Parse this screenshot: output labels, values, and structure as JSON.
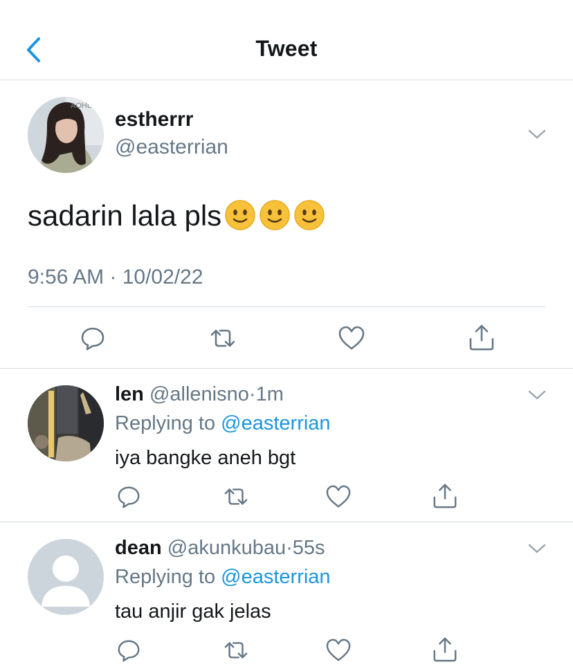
{
  "header": {
    "title": "Tweet",
    "back_icon": "chevron-left-icon"
  },
  "colors": {
    "accent": "#1b95e0",
    "muted": "#657786",
    "divider": "#d8dde1"
  },
  "tweet": {
    "display_name": "estherrr",
    "handle": "@easterrian",
    "text": "sadarin lala pls",
    "emoji": [
      "slightly-smiling-face-emoji",
      "slightly-smiling-face-emoji",
      "slightly-smiling-face-emoji"
    ],
    "timestamp": "9:56 AM · 10/02/22",
    "avatar_overlay_text": "AQHL",
    "actions": [
      "reply-icon",
      "retweet-icon",
      "like-icon",
      "share-icon"
    ]
  },
  "replies": [
    {
      "display_name": "len",
      "handle": "@allenisno",
      "separator": "·",
      "time": "1m",
      "replying_label": "Replying to",
      "replying_handle": "@easterrian",
      "text": "iya bangke aneh bgt"
    },
    {
      "display_name": "dean",
      "handle": "@akunkubau",
      "separator": "·",
      "time": "55s",
      "replying_label": "Replying to",
      "replying_handle": "@easterrian",
      "text": "tau anjir gak jelas"
    }
  ]
}
